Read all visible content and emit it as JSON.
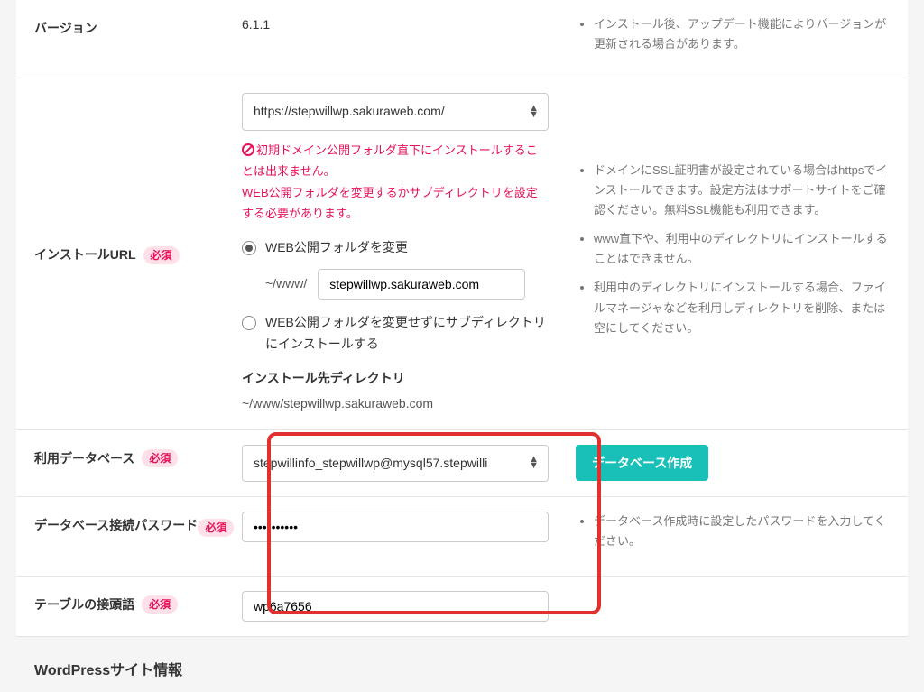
{
  "labels": {
    "version": "バージョン",
    "install_url": "インストールURL",
    "database": "利用データベース",
    "db_password": "データベース接続パスワード",
    "table_prefix": "テーブルの接頭語",
    "required": "必須"
  },
  "values": {
    "version": "6.1.1",
    "url_select": "https://stepwillwp.sakuraweb.com/",
    "www_path_prefix": "~/www/",
    "www_folder_input": "stepwillwp.sakuraweb.com",
    "install_dir_label": "インストール先ディレクトリ",
    "install_dir_path": "~/www/stepwillwp.sakuraweb.com",
    "database_select": "stepwillinfo_stepwillwp@mysql57.stepwilli",
    "db_password": "••••••••••",
    "table_prefix": "wp6a7656"
  },
  "warning": {
    "line1": "初期ドメイン公開フォルダ直下にインストールすることは出来ません。",
    "line2": "WEB公開フォルダを変更するかサブディレクトリを設定する必要があります。"
  },
  "radio": {
    "change_folder": "WEB公開フォルダを変更",
    "use_subdir": "WEB公開フォルダを変更せずにサブディレクトリにインストールする"
  },
  "help": {
    "version": "インストール後、アップデート機能によりバージョンが更新される場合があります。",
    "url_ssl": "ドメインにSSL証明書が設定されている場合はhttpsでインストールできます。設定方法はサポートサイトをご確認ください。無料SSL機能も利用できます。",
    "url_www": "www直下や、利用中のディレクトリにインストールすることはできません。",
    "url_dir": "利用中のディレクトリにインストールする場合、ファイルマネージャなどを利用しディレクトリを削除、または空にしてください。",
    "db_password": "データベース作成時に設定したパスワードを入力してください。"
  },
  "buttons": {
    "create_db": "データベース作成"
  },
  "section": {
    "wp_site_info": "WordPressサイト情報"
  }
}
